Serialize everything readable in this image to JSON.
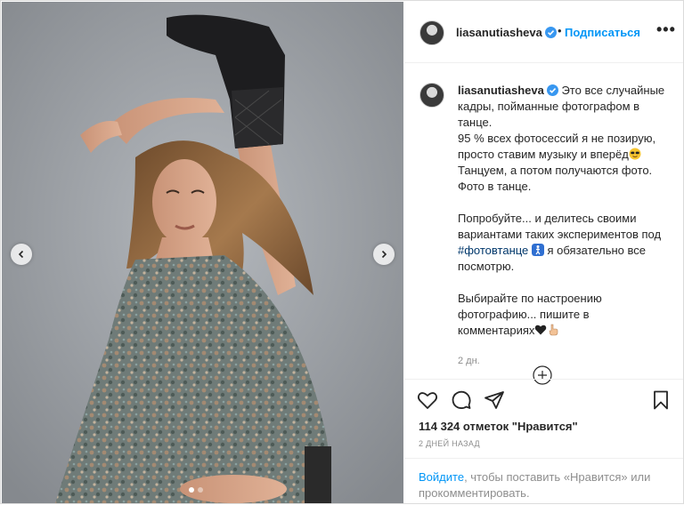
{
  "post": {
    "username": "liasanutiasheva",
    "follow_label": "Подписаться",
    "more_label": "•••",
    "header_separator": "•"
  },
  "caption": {
    "username": "liasanutiasheva",
    "line1": "Это все случайные кадры, пойманные фотографом в танце.",
    "line2": "95 % всех фотосессий я не позирую, просто ставим музыку и вперёд",
    "line3": "Танцуем, а потом получаются фото.",
    "line4": "Фото в танце.",
    "line5_a": "Попробуйте... и делитесь своими вариантами таких экспериментов под ",
    "hashtag": "#фотовтанце",
    "line5_b": " я обязательно все посмотрю.",
    "line6": "Выбирайте по настроению фотографию... пишите в комментариях",
    "time": "2 дн."
  },
  "icons": {
    "verified": "verified-badge-icon",
    "like": "heart-icon",
    "comment": "comment-icon",
    "share": "share-icon",
    "save": "bookmark-icon",
    "load_more": "plus-circle-icon",
    "prev": "chevron-left-icon",
    "next": "chevron-right-icon"
  },
  "stats": {
    "likes": "114 324 отметок \"Нравится\"",
    "posted": "2 ДНЕЙ НАЗАД"
  },
  "login": {
    "link": "Войдите",
    "rest": ", чтобы поставить «Нравится» или прокомментировать."
  },
  "carousel": {
    "total": 2,
    "active": 1
  },
  "colors": {
    "accent": "#0095f6",
    "hashtag": "#00376b",
    "muted": "#8e8e8e",
    "text": "#262626"
  }
}
